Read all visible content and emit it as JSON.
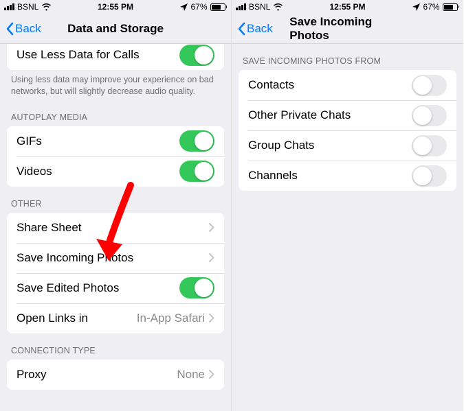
{
  "statusbar": {
    "carrier": "BSNL",
    "time": "12:55 PM",
    "battery": "67%"
  },
  "left": {
    "back": "Back",
    "title": "Data and Storage",
    "useLessData": {
      "label": "Use Less Data for Calls"
    },
    "footer": "Using less data may improve your experience on bad networks, but will slightly decrease audio quality.",
    "autoplayHeader": "AUTOPLAY MEDIA",
    "gifs": "GIFs",
    "videos": "Videos",
    "otherHeader": "OTHER",
    "shareSheet": "Share Sheet",
    "saveIncoming": "Save Incoming Photos",
    "saveEdited": "Save Edited Photos",
    "openLinks": "Open Links in",
    "openLinksValue": "In-App Safari",
    "connectionHeader": "CONNECTION TYPE",
    "proxy": "Proxy",
    "proxyValue": "None"
  },
  "right": {
    "back": "Back",
    "title": "Save Incoming Photos",
    "header": "SAVE INCOMING PHOTOS FROM",
    "contacts": "Contacts",
    "otherChats": "Other Private Chats",
    "groupChats": "Group Chats",
    "channels": "Channels"
  }
}
